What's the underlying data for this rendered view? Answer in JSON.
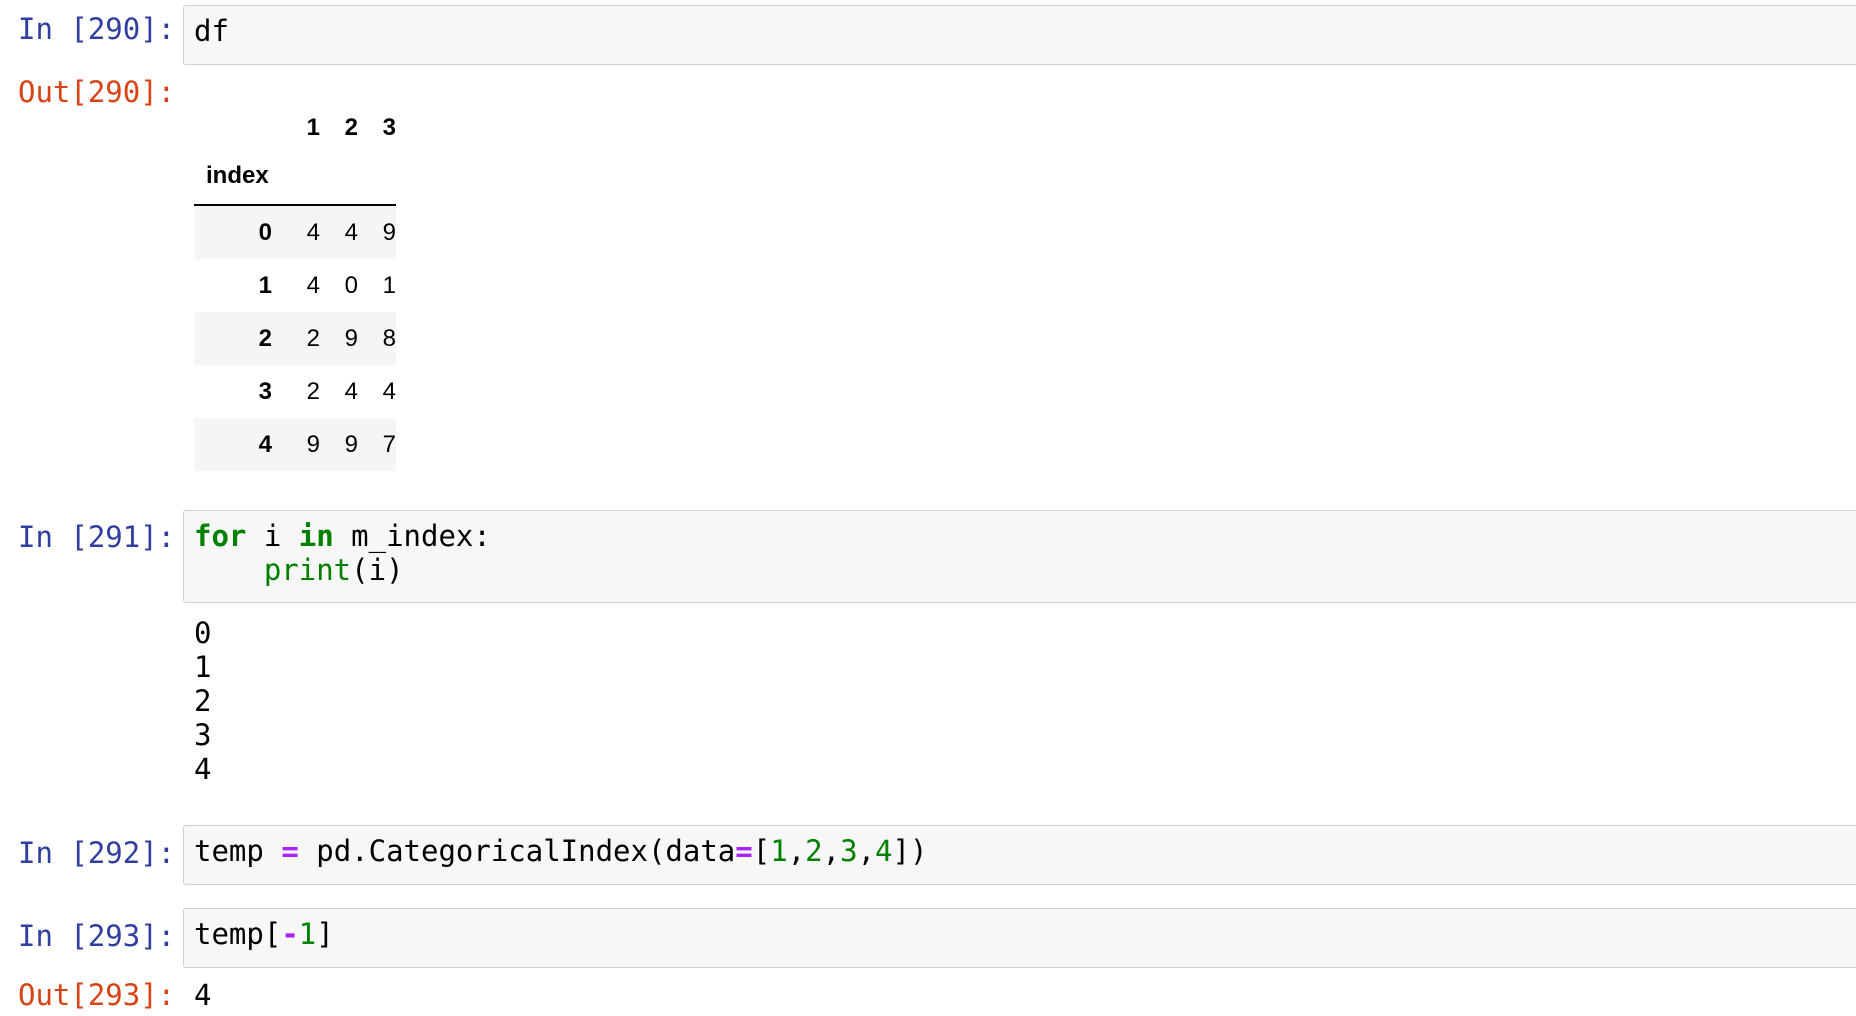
{
  "cells": [
    {
      "in_prompt": "In [290]:",
      "code": "df",
      "out_prompt": "Out[290]:"
    },
    {
      "in_prompt": "In [291]:",
      "code_line1": {
        "kw1": "for",
        "t1": " i ",
        "kw2": "in",
        "t2": " m_index:"
      },
      "code_line2": {
        "indent": "    ",
        "fn": "print",
        "t": "(i)"
      },
      "stdout": [
        "0",
        "1",
        "2",
        "3",
        "4"
      ]
    },
    {
      "in_prompt": "In [292]:",
      "code": {
        "a": "temp ",
        "eq": "=",
        "b": " pd.CategoricalIndex(data",
        "eq2": "=",
        "c": "[",
        "n1": "1",
        "s1": ",",
        "n2": "2",
        "s2": ",",
        "n3": "3",
        "s3": ",",
        "n4": "4",
        "d": "])"
      }
    },
    {
      "in_prompt": "In [293]:",
      "code": {
        "a": "temp[",
        "op": "-",
        "n": "1",
        "b": "]"
      },
      "out_prompt": "Out[293]:",
      "out_value": "4"
    }
  ],
  "dataframe": {
    "columns": [
      "1",
      "2",
      "3"
    ],
    "index_name": "index",
    "rows": [
      {
        "idx": "0",
        "values": [
          "4",
          "4",
          "9"
        ]
      },
      {
        "idx": "1",
        "values": [
          "4",
          "0",
          "1"
        ]
      },
      {
        "idx": "2",
        "values": [
          "2",
          "9",
          "8"
        ]
      },
      {
        "idx": "3",
        "values": [
          "2",
          "4",
          "4"
        ]
      },
      {
        "idx": "4",
        "values": [
          "9",
          "9",
          "7"
        ]
      }
    ]
  }
}
